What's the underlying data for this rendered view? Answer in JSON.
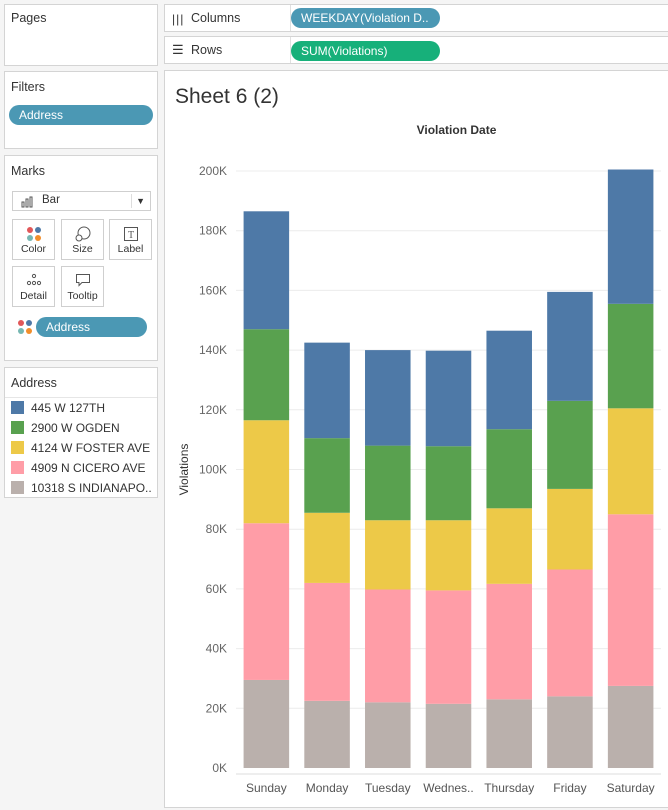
{
  "pages_panel": {
    "title": "Pages"
  },
  "shelves": {
    "columns_label": "Columns",
    "columns_pill": "WEEKDAY(Violation D..",
    "rows_label": "Rows",
    "rows_pill": "SUM(Violations)"
  },
  "filters_panel": {
    "title": "Filters",
    "pill": "Address"
  },
  "marks_panel": {
    "title": "Marks",
    "mark_type": "Bar",
    "buttons": {
      "color": "Color",
      "size": "Size",
      "label": "Label",
      "detail": "Detail",
      "tooltip": "Tooltip"
    },
    "color_pill": "Address"
  },
  "legend": {
    "title": "Address",
    "items": [
      {
        "label": "445 W 127TH",
        "color": "#4e79a7"
      },
      {
        "label": "2900 W OGDEN",
        "color": "#59a14f"
      },
      {
        "label": "4124 W FOSTER AVE",
        "color": "#edc948"
      },
      {
        "label": "4909 N CICERO AVE",
        "color": "#ff9da7"
      },
      {
        "label": "10318 S INDIANAPO..",
        "color": "#bab0ac"
      }
    ]
  },
  "sheet": {
    "title": "Sheet 6 (2)"
  },
  "chart_data": {
    "type": "bar",
    "stacked": true,
    "title": "Violation Date",
    "xlabel": "",
    "ylabel": "Violations",
    "ylim": [
      0,
      200000
    ],
    "yticks": [
      0,
      20000,
      40000,
      60000,
      80000,
      100000,
      120000,
      140000,
      160000,
      180000,
      200000
    ],
    "ytick_labels": [
      "0K",
      "20K",
      "40K",
      "60K",
      "80K",
      "100K",
      "120K",
      "140K",
      "160K",
      "180K",
      "200K"
    ],
    "categories": [
      "Sunday",
      "Monday",
      "Tuesday",
      "Wednes..",
      "Thursday",
      "Friday",
      "Saturday"
    ],
    "series": [
      {
        "name": "10318 S INDIANAPO..",
        "color": "#bab0ac",
        "values": [
          29500,
          22500,
          22000,
          21500,
          23000,
          24000,
          27500
        ]
      },
      {
        "name": "4909 N CICERO AVE",
        "color": "#ff9da7",
        "values": [
          52500,
          39500,
          37800,
          38000,
          38700,
          42500,
          57500
        ]
      },
      {
        "name": "4124 W FOSTER AVE",
        "color": "#edc948",
        "values": [
          34500,
          23500,
          23200,
          23500,
          25300,
          27000,
          35500
        ]
      },
      {
        "name": "2900 W OGDEN",
        "color": "#59a14f",
        "values": [
          30500,
          25000,
          25000,
          24800,
          26500,
          29500,
          35000
        ]
      },
      {
        "name": "445 W 127TH",
        "color": "#4e79a7",
        "values": [
          39500,
          32000,
          32000,
          32000,
          33000,
          36500,
          45000
        ]
      }
    ],
    "grid": true,
    "legend": "left panel"
  }
}
